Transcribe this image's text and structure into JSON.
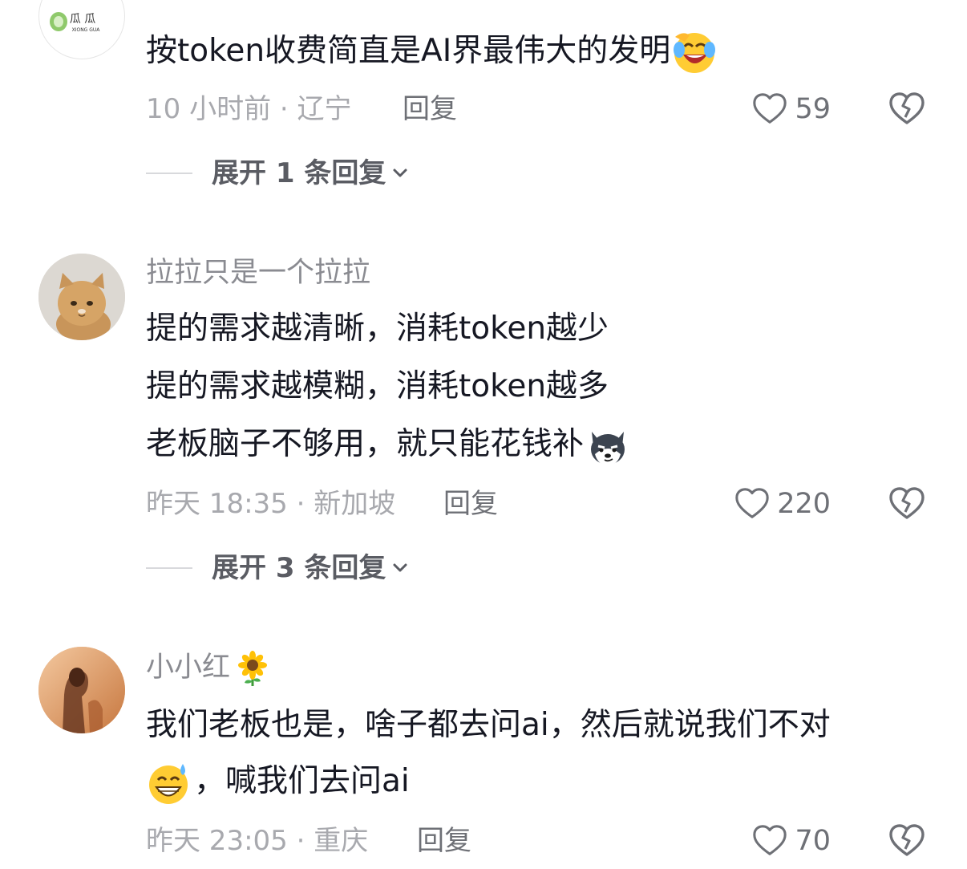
{
  "comments": [
    {
      "username": "",
      "avatar": "xigua-logo",
      "avatar_text": "XIONG GUA",
      "lines": [
        "按token收费简直是AI界最伟大的发明"
      ],
      "emoji": "laughing-crying-face",
      "meta": "10 小时前 · 辽宁",
      "reply_label": "回复",
      "likes": "59",
      "expand_label": "展开 1 条回复"
    },
    {
      "username": "拉拉只是一个拉拉",
      "avatar": "kitten-photo",
      "lines": [
        "提的需求越清晰，消耗token越少",
        "提的需求越模糊，消耗token越多",
        "老板脑子不够用，就只能花钱补"
      ],
      "emoji": "husky-dog-face",
      "meta": "昨天 18:35 · 新加坡",
      "reply_label": "回复",
      "likes": "220",
      "expand_label": "展开 3 条回复"
    },
    {
      "username": "小小红",
      "username_emoji": "sunflower",
      "avatar": "person-silhouette-photo",
      "lines": [
        "我们老板也是，啥子都去问ai，然后就说我们不对",
        "，喊我们去问ai"
      ],
      "emoji": "grinning-sweat-face",
      "meta": "昨天 23:05 · 重庆",
      "reply_label": "回复",
      "likes": "70"
    }
  ],
  "colors": {
    "text": "#161823",
    "secondary": "#a8a9ae",
    "action": "#6e7076"
  }
}
